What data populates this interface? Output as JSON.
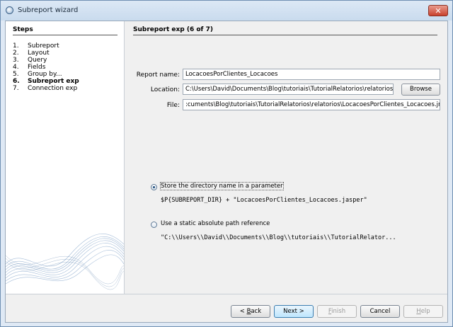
{
  "window": {
    "title": "Subreport wizard",
    "close_glyph": "✕",
    "icon": "wizard-app-icon"
  },
  "steps": {
    "heading": "Steps",
    "items": [
      {
        "num": "1.",
        "label": "Subreport"
      },
      {
        "num": "2.",
        "label": "Layout"
      },
      {
        "num": "3.",
        "label": "Query"
      },
      {
        "num": "4.",
        "label": "Fields"
      },
      {
        "num": "5.",
        "label": "Group by..."
      },
      {
        "num": "6.",
        "label": "Subreport exp"
      },
      {
        "num": "7.",
        "label": "Connection exp"
      }
    ],
    "current_index": 5
  },
  "panel": {
    "heading": "Subreport exp (6 of 7)",
    "report_name_label": "Report name:",
    "report_name_value": "LocacoesPorClientes_Locacoes",
    "location_label": "Location:",
    "location_value": "C:\\Users\\David\\Documents\\Blog\\tutoriais\\TutorialRelatorios\\relatorios",
    "browse_label": "Browse",
    "file_label": "File:",
    "file_value": ":cuments\\Blog\\tutoriais\\TutorialRelatorios\\relatorios\\LocacoesPorClientes_Locacoes.jrxml",
    "option_parameter_label": "Store the directory name in a parameter",
    "option_parameter_expr": "$P{SUBREPORT_DIR} + \"LocacoesPorClientes_Locacoes.jasper\"",
    "option_static_label": "Use a static absolute path reference",
    "option_static_expr": "\"C:\\\\Users\\\\David\\\\Documents\\\\Blog\\\\tutoriais\\\\TutorialRelator...",
    "selected_option": "parameter"
  },
  "buttons": {
    "back_prefix": "< ",
    "back_key": "B",
    "back_rest": "ack",
    "next": "Next >",
    "finish_key": "F",
    "finish_rest": "inish",
    "cancel": "Cancel",
    "help_key": "H",
    "help_rest": "elp"
  }
}
